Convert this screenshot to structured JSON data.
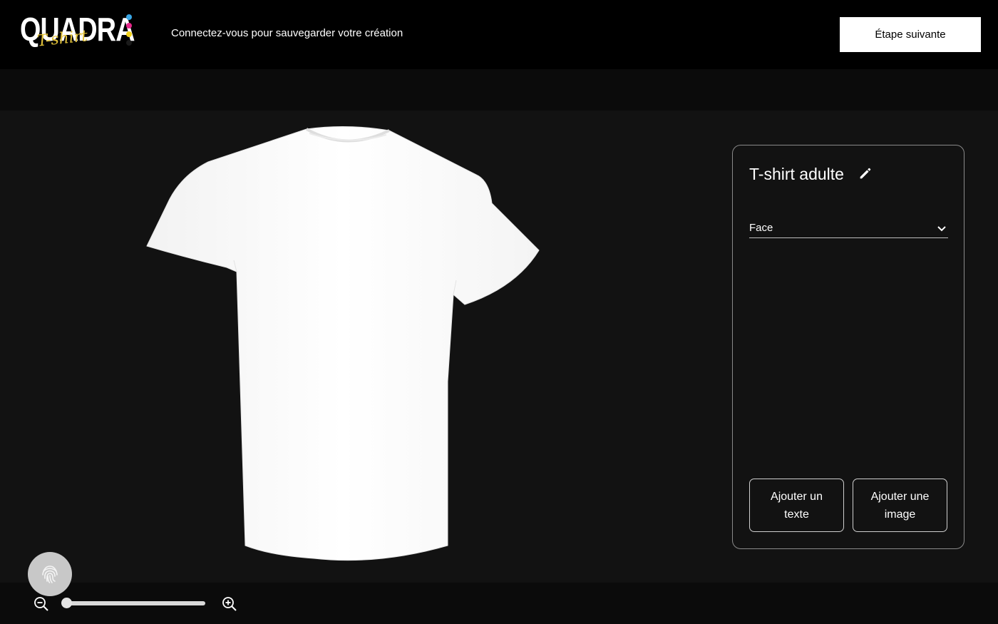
{
  "header": {
    "logo_word": "QUADRA",
    "logo_script": "T-shirt",
    "signin_prompt": "Connectez-vous pour sauvegarder votre création",
    "next_step_label": "Étape suivante"
  },
  "panel": {
    "title": "T-shirt adulte",
    "side_select": {
      "value": "Face"
    },
    "add_text_label": "Ajouter un texte",
    "add_image_label": "Ajouter une image"
  },
  "zoom": {
    "level": 0.0
  },
  "colors": {
    "background": "#121212",
    "topbar": "#000000",
    "bar": "#0b0b0b",
    "logo_accent": "#e2c23a",
    "logo_dots": [
      "#3aa7e6",
      "#e6268a",
      "#f2d21a",
      "#111111"
    ]
  },
  "icons": {
    "edit": "pencil-icon",
    "select": "chevron-down-icon",
    "zoom_out": "zoom-out-icon",
    "zoom_in": "zoom-in-icon",
    "floating": "fingerprint-icon"
  }
}
